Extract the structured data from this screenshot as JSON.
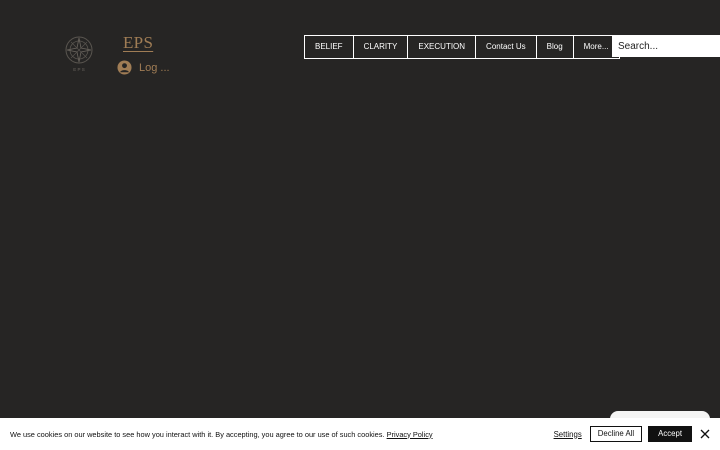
{
  "header": {
    "brand": "EPS",
    "emblem_text": "E P S",
    "login_label": "Log ...",
    "search_placeholder": "Search..."
  },
  "nav": {
    "items": [
      "BELIEF",
      "CLARITY",
      "EXECUTION",
      "Contact Us",
      "Blog",
      "More..."
    ]
  },
  "cookie": {
    "message": "We use cookies on our website to see how you interact with it. By accepting, you agree to our use of such cookies.",
    "privacy_link": "Privacy Policy",
    "settings_label": "Settings",
    "decline_label": "Decline All",
    "accept_label": "Accept"
  },
  "colors": {
    "background": "#262524",
    "accent": "#a07d55",
    "bar": "#ffffff"
  },
  "icons": {
    "emblem": "compass-emblem-icon",
    "login": "user-avatar-icon",
    "close": "close-icon"
  }
}
